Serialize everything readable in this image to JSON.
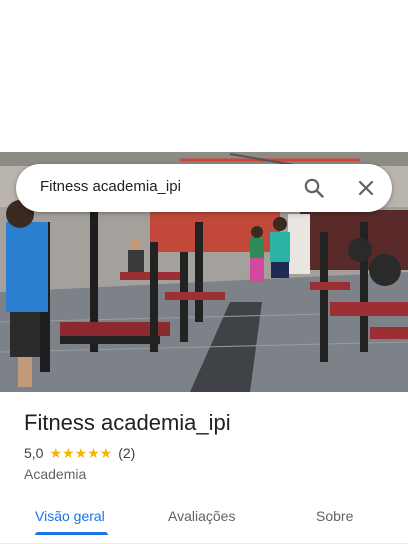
{
  "search": {
    "query": "Fitness academia_ipi",
    "icons": {
      "search": "search-icon",
      "close": "close-icon"
    }
  },
  "place": {
    "title": "Fitness academia_ipi",
    "rating": "5,0",
    "stars": "★★★★★",
    "star_count": 5,
    "review_count": "(2)",
    "category": "Academia"
  },
  "tabs": [
    {
      "label": "Visão geral",
      "active": true
    },
    {
      "label": "Avaliações",
      "active": false
    },
    {
      "label": "Sobre",
      "active": false
    }
  ],
  "colors": {
    "accent": "#1a73e8",
    "star": "#f4b400",
    "text_primary": "#202124",
    "text_secondary": "#5f6368"
  }
}
